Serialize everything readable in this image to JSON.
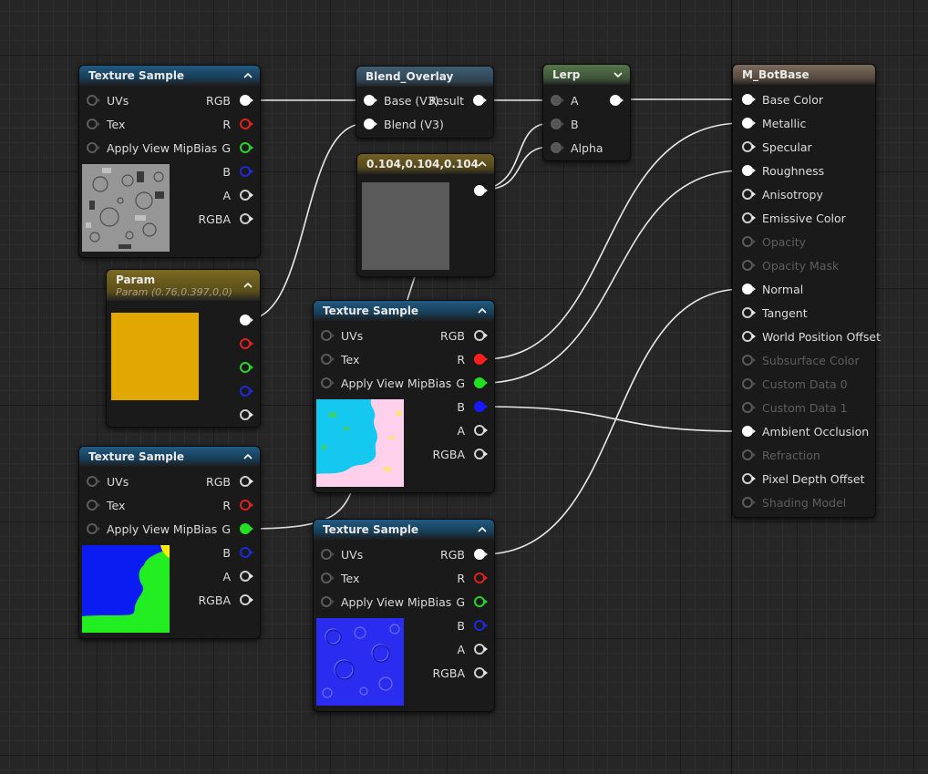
{
  "nodes": {
    "tex1": {
      "title": "Texture Sample",
      "inputs": [
        "UVs",
        "Tex",
        "Apply View MipBias"
      ],
      "outputs": [
        "RGB",
        "R",
        "G",
        "B",
        "A",
        "RGBA"
      ]
    },
    "param": {
      "title": "Param",
      "subtitle": "Param (0.76,0.397,0,0)",
      "color": "#e0a800"
    },
    "tex3": {
      "title": "Texture Sample",
      "inputs": [
        "UVs",
        "Tex",
        "Apply View MipBias"
      ],
      "outputs": [
        "RGB",
        "R",
        "G",
        "B",
        "A",
        "RGBA"
      ]
    },
    "blend": {
      "title": "Blend_Overlay",
      "inputs": [
        "Base (V3)",
        "Blend (V3)"
      ],
      "outputs": [
        "Result"
      ]
    },
    "vec": {
      "title": "0.104,0.104,0.104",
      "color": "#5a5a5a"
    },
    "tex2": {
      "title": "Texture Sample",
      "inputs": [
        "UVs",
        "Tex",
        "Apply View MipBias"
      ],
      "outputs": [
        "RGB",
        "R",
        "G",
        "B",
        "A",
        "RGBA"
      ]
    },
    "tex4": {
      "title": "Texture Sample",
      "inputs": [
        "UVs",
        "Tex",
        "Apply View MipBias"
      ],
      "outputs": [
        "RGB",
        "R",
        "G",
        "B",
        "A",
        "RGBA"
      ]
    },
    "lerp": {
      "title": "Lerp",
      "inputs": [
        "A",
        "B",
        "Alpha"
      ]
    },
    "material": {
      "title": "M_BotBase",
      "inputs": [
        {
          "label": "Base Color",
          "enabled": true
        },
        {
          "label": "Metallic",
          "enabled": true
        },
        {
          "label": "Specular",
          "enabled": true
        },
        {
          "label": "Roughness",
          "enabled": true
        },
        {
          "label": "Anisotropy",
          "enabled": true
        },
        {
          "label": "Emissive Color",
          "enabled": true
        },
        {
          "label": "Opacity",
          "enabled": false
        },
        {
          "label": "Opacity Mask",
          "enabled": false
        },
        {
          "label": "Normal",
          "enabled": true
        },
        {
          "label": "Tangent",
          "enabled": true
        },
        {
          "label": "World Position Offset",
          "enabled": true
        },
        {
          "label": "Subsurface Color",
          "enabled": false
        },
        {
          "label": "Custom Data 0",
          "enabled": false
        },
        {
          "label": "Custom Data 1",
          "enabled": false
        },
        {
          "label": "Ambient Occlusion",
          "enabled": true
        },
        {
          "label": "Refraction",
          "enabled": false
        },
        {
          "label": "Pixel Depth Offset",
          "enabled": true
        },
        {
          "label": "Shading Model",
          "enabled": false
        }
      ]
    }
  },
  "colors": {
    "canvas": "#262626",
    "wire": "#e8e8e8",
    "pin_r": "#ff1e1e",
    "pin_g": "#22e022",
    "pin_b": "#1818ff"
  }
}
